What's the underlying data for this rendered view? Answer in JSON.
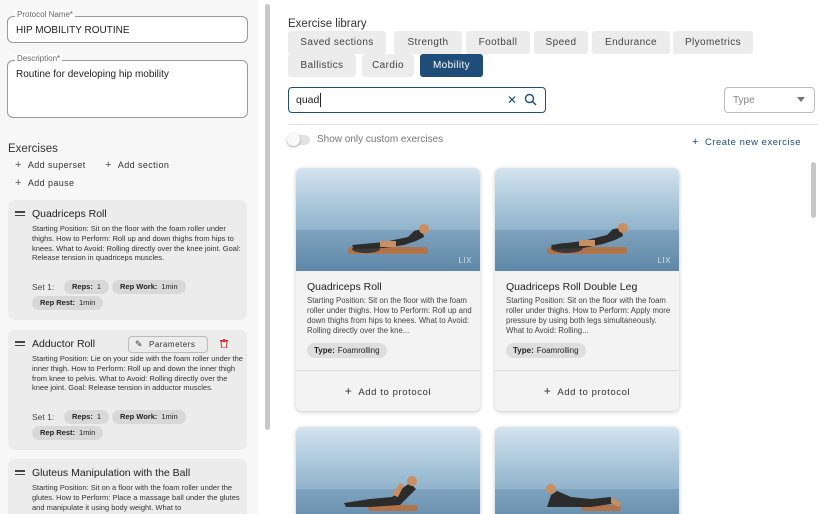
{
  "protocol": {
    "name_label": "Protocol Name*",
    "name_value": "HIP MOBILITY ROUTINE",
    "desc_label": "Description*",
    "desc_value": "Routine for developing hip mobility"
  },
  "exercises_section": {
    "title": "Exercises",
    "add_superset": "Add superset",
    "add_section": "Add section",
    "add_pause": "Add pause"
  },
  "exercises": [
    {
      "name": "Quadriceps Roll",
      "description": "Starting Position: Sit on the floor with the foam roller under thighs. How to Perform: Roll up and down thighs from hips to knees. What to Avoid: Rolling directly over the knee joint. Goal: Release tension in quadriceps muscles.",
      "set_label": "Set 1:",
      "reps_label": "Reps:",
      "reps_value": "1",
      "rep_work_label": "Rep Work:",
      "rep_work_value": "1min",
      "rep_rest_label": "Rep Rest:",
      "rep_rest_value": "1min"
    },
    {
      "name": "Adductor Roll",
      "parameters_label": "Parameters",
      "description": "Starting Position: Lie on your side with the foam roller under the inner thigh. How to Perform: Roll up and down the inner thigh from knee to pelvis. What to Avoid: Rolling directly over the knee joint. Goal: Release tension in adductor muscles.",
      "set_label": "Set 1:",
      "reps_label": "Reps:",
      "reps_value": "1",
      "rep_work_label": "Rep Work:",
      "rep_work_value": "1min",
      "rep_rest_label": "Rep Rest:",
      "rep_rest_value": "1min"
    },
    {
      "name": "Gluteus Manipulation with the Ball",
      "description": "Starting Position: Sit on a floor with the foam roller under the glutes. How to Perform: Place a massage ball under the glutes and manipulate it using body weight. What to"
    }
  ],
  "library": {
    "title": "Exercise library",
    "tabs": [
      "Saved sections",
      "Strength",
      "Football",
      "Speed",
      "Endurance",
      "Plyometrics",
      "Ballistics",
      "Cardio",
      "Mobility"
    ],
    "active_tab": "Mobility",
    "search_value": "quad",
    "type_placeholder": "Type",
    "toggle_label": "Show only custom exercises",
    "toggle_on": false,
    "create_label": "Create new exercise",
    "accent_color": "#1f4d7a"
  },
  "cards": [
    {
      "title": "Quadriceps Roll",
      "description": "Starting Position: Sit on the floor with the foam roller under thighs. How to Perform: Roll up and down thighs from hips to knees. What to Avoid: Rolling directly over the kne...",
      "type_label": "Type:",
      "type_value": "Foamrolling",
      "add_label": "Add to protocol",
      "watermark": "LIX"
    },
    {
      "title": "Quadriceps Roll Double Leg",
      "description": "Starting Position: Sit on the floor with the foam roller under thighs. How to Perform: Apply more pressure by using both legs simultaneously. What to Avoid: Rolling...",
      "type_label": "Type:",
      "type_value": "Foamrolling",
      "add_label": "Add to protocol",
      "watermark": "LIX"
    }
  ]
}
